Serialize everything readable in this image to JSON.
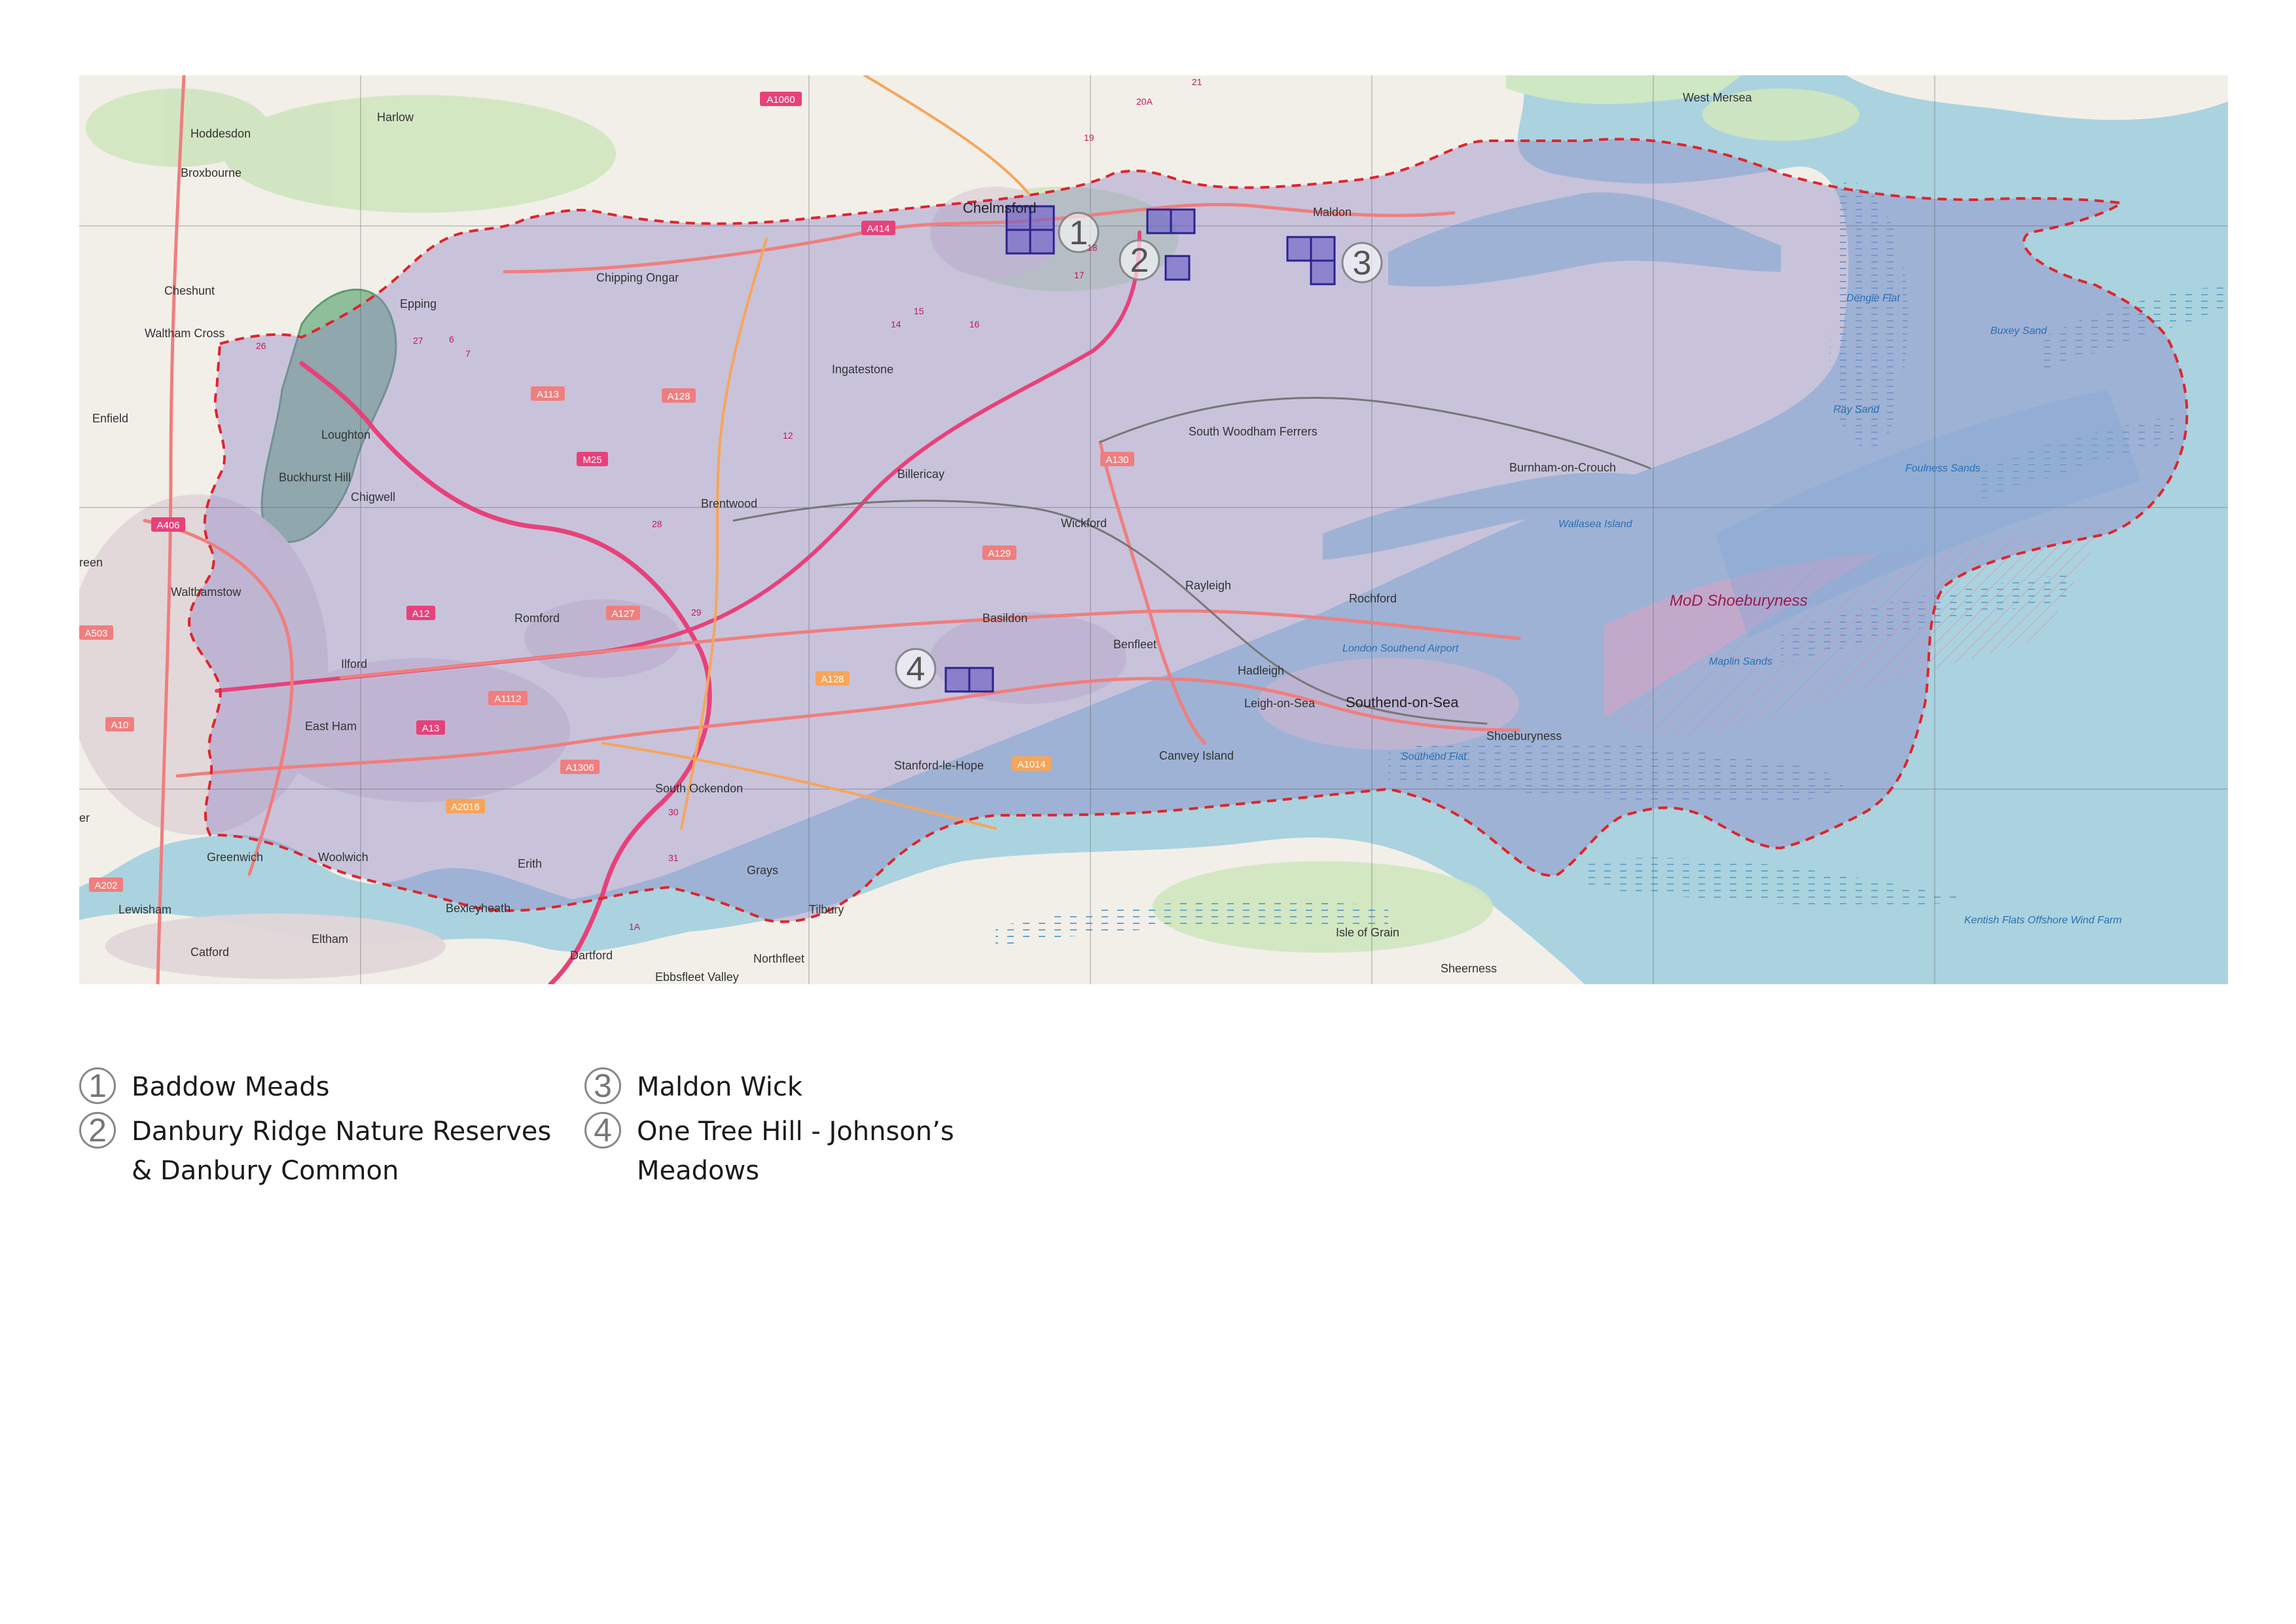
{
  "map": {
    "places": [
      "West Mersea",
      "Harlow",
      "Hoddesdon",
      "Broxbourne",
      "Chelmsford",
      "Maldon",
      "Cheshunt",
      "Chipping Ongar",
      "Epping",
      "Waltham Cross",
      "Ingatestone",
      "Enfield",
      "Loughton",
      "Buckhurst Hill",
      "Chigwell",
      "South Woodham Ferrers",
      "Burnham-on-Crouch",
      "Billericay",
      "Brentwood",
      "Wickford",
      "Walthamstow",
      "Rayleigh",
      "Rochford",
      "Romford",
      "Basildon",
      "Benfleet",
      "Hadleigh",
      "Ilford",
      "Leigh-on-Sea",
      "Southend-on-Sea",
      "East Ham",
      "Canvey Island",
      "Shoeburyness",
      "Stanford-le-Hope",
      "South Ockendon",
      "Greenwich",
      "Woolwich",
      "Erith",
      "Grays",
      "Tilbury",
      "Bexleyheath",
      "Lewisham",
      "Catford",
      "Eltham",
      "Dartford",
      "Ebbsfleet Valley",
      "Northfleet",
      "Isle of Grain",
      "Sheerness",
      "reen",
      "er"
    ],
    "roads": [
      "A1060",
      "A414",
      "A113",
      "A128",
      "M25",
      "A130",
      "A406",
      "A129",
      "A12",
      "A127",
      "A503",
      "A1112",
      "A13",
      "A10",
      "A1306",
      "A2016",
      "A202",
      "A1014",
      "A128"
    ],
    "junctions": [
      "26",
      "27",
      "6",
      "7",
      "28",
      "29",
      "30",
      "31",
      "1A",
      "12",
      "14",
      "15",
      "16",
      "17",
      "18",
      "19",
      "20A",
      "21"
    ],
    "sea_labels": [
      "Dengie Flat",
      "Buxey Sand",
      "Ray Sand",
      "Foulness Sands",
      "Maplin Sands",
      "Wallasea Island",
      "Southend Flat",
      "London Southend Airport",
      "Kentish Flats Offshore Wind Farm"
    ],
    "restricted_area": "MoD Shoeburyness",
    "site_markers": [
      "1",
      "2",
      "3",
      "4"
    ],
    "colors": {
      "sea": "#aad3df",
      "land": "#f2efe9",
      "region_overlay": "#8e86c9",
      "boundary": "#e0242b",
      "site_fill": "#6f63c7",
      "site_stroke": "#2b2290",
      "mod_area": "#e8a0c0",
      "motorway": "#e8417a",
      "primary_road": "#f07e7e"
    }
  },
  "legend": {
    "items": [
      {
        "number": "1",
        "label": "Baddow Meads"
      },
      {
        "number": "2",
        "label": "Danbury Ridge Nature Reserves & Danbury  Common"
      },
      {
        "number": "3",
        "label": "Maldon Wick"
      },
      {
        "number": "4",
        "label": "One Tree Hill - Johnson’s Meadows"
      }
    ]
  }
}
